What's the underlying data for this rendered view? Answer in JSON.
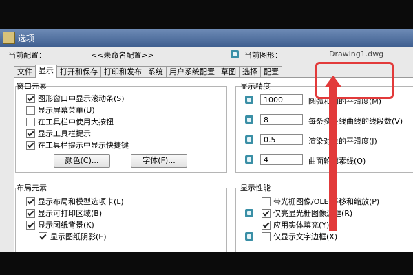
{
  "window": {
    "title": "选项"
  },
  "profile": {
    "current_profile_label": "当前配置：",
    "current_profile_value": "<<未命名配置>>",
    "current_drawing_label": "当前图形：",
    "current_drawing_value": "Drawing1.dwg"
  },
  "tabs": [
    "文件",
    "显示",
    "打开和保存",
    "打印和发布",
    "系统",
    "用户系统配置",
    "草图",
    "选择",
    "配置"
  ],
  "active_tab": "显示",
  "window_elements": {
    "title": "窗口元素",
    "items": [
      {
        "label": "图形窗口中显示滚动条(S)",
        "checked": true
      },
      {
        "label": "显示屏幕菜单(U)",
        "checked": false
      },
      {
        "label": "在工具栏中使用大按钮",
        "checked": false
      },
      {
        "label": "显示工具栏提示",
        "checked": true
      },
      {
        "label": "在工具栏提示中显示快捷键",
        "checked": true
      }
    ],
    "color_button": "颜色(C)...",
    "font_button": "字体(F)..."
  },
  "display_resolution": {
    "title": "显示精度",
    "items": [
      {
        "value": "1000",
        "label": "圆弧和圆的平滑度(M)"
      },
      {
        "value": "8",
        "label": "每条多段线曲线的线段数(V)"
      },
      {
        "value": "0.5",
        "label": "渲染对象的平滑度(J)"
      },
      {
        "value": "4",
        "label": "曲面轮廓素线(O)"
      }
    ]
  },
  "layout_elements": {
    "title": "布局元素",
    "items": [
      {
        "label": "显示布局和模型选项卡(L)",
        "checked": true
      },
      {
        "label": "显示可打印区域(B)",
        "checked": true
      },
      {
        "label": "显示图纸背景(K)",
        "checked": true
      },
      {
        "label": "显示图纸阴影(E)",
        "checked": true
      }
    ]
  },
  "display_performance": {
    "title": "显示性能",
    "items": [
      {
        "label": "带光栅图像/OLE 平移和缩放(P)",
        "checked": false
      },
      {
        "label": "仅亮显光栅图像边框(R)",
        "checked": true
      },
      {
        "label": "应用实体填充(Y)",
        "checked": true
      },
      {
        "label": "仅显示文字边框(X)",
        "checked": false
      }
    ]
  },
  "colors": {
    "annotation": "#e23a3a",
    "title_bar": "#3f5f90"
  }
}
